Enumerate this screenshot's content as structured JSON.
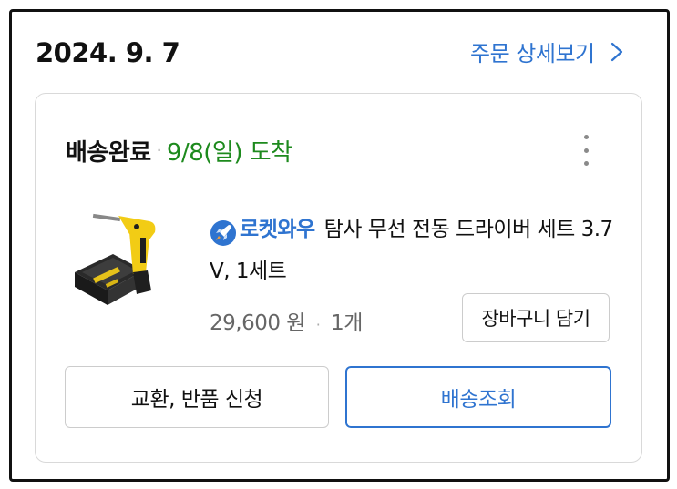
{
  "order": {
    "date": "2024. 9. 7",
    "detail_link": "주문 상세보기"
  },
  "delivery": {
    "status": "배송완료",
    "separator": "·",
    "arrival": "9/8(일) 도착"
  },
  "product": {
    "badge": "로켓와우",
    "title": "탐사 무선 전동 드라이버 세트 3.7 V, 1세트",
    "price": "29,600 원",
    "separator": "·",
    "quantity": "1개",
    "image_icon": "cordless-screwdriver-set-image",
    "badge_icon": "rocket-icon"
  },
  "actions": {
    "cart": "장바구니 담기",
    "return": "교환, 반품 신청",
    "track": "배송조회"
  },
  "colors": {
    "accent": "#2f74d0",
    "arrival": "#1d8a1d"
  }
}
